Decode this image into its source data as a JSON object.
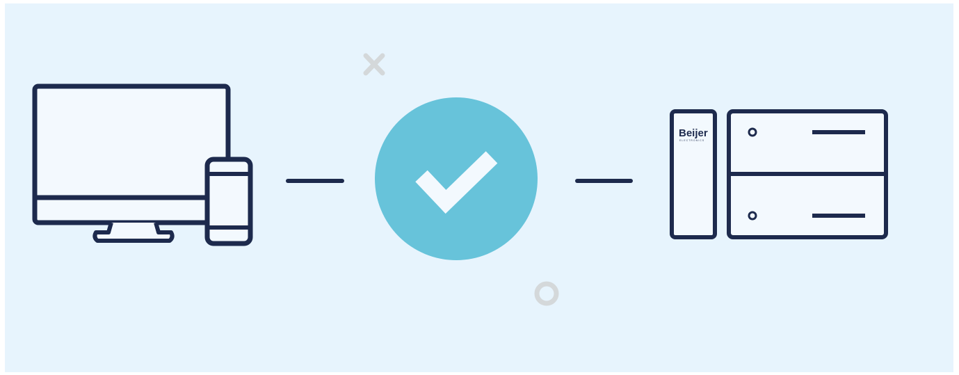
{
  "diagram": {
    "colors": {
      "background": "#e7f4fd",
      "outline": "#1d2a4d",
      "device_fill": "#f3f9fe",
      "check_circle": "#67c3da",
      "check_mark": "#f3f9fe",
      "decoration": "#d4d8da"
    },
    "devices": {
      "client": {
        "icons": [
          "monitor-icon",
          "smartphone-icon"
        ]
      },
      "server": {
        "icons": [
          "controller-module-icon",
          "server-rack-icon"
        ],
        "brand_logo": {
          "text": "Beijer",
          "subtext": "ELECTRONICS"
        }
      }
    },
    "status": {
      "icon": "checkmark-icon",
      "state": "connected"
    },
    "decorations": [
      "cross-icon",
      "ring-icon"
    ]
  }
}
